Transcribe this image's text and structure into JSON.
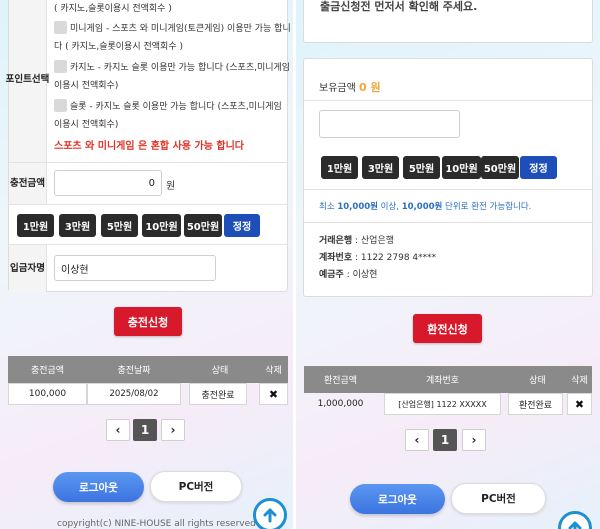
{
  "left": {
    "point_select": {
      "label": "포인트선택",
      "note_top": "( 카지노,슬롯이용시 전액회수 )",
      "options": [
        {
          "text": "미니게임 - 스포츠 와 미니게임(토큰게임) 이용만 가능 합니",
          "text2": "다 ( 카지노,슬롯이용시 전액회수 )"
        },
        {
          "text": "카지노 - 카지노 슬롯 이용만 가능 합니다 (스포츠,미니게임",
          "text2": "이용시 전액회수)"
        },
        {
          "text": "슬롯 - 카지노 슬롯 이용만 가능 합니다 (스포츠,미니게임",
          "text2": "이용시 전액회수)"
        }
      ],
      "warning": "스포츠 와 미니게임 은 혼합 사용 가능 합니다"
    },
    "charge_amount": {
      "label": "충전금액",
      "value": "0",
      "unit": "원"
    },
    "amount_buttons": [
      "1만원",
      "3만원",
      "5만원",
      "10만원",
      "50만원"
    ],
    "reset_label": "정정",
    "depositor": {
      "label": "입금자명",
      "value": "이상현"
    },
    "submit_label": "충전신청",
    "table": {
      "headers": [
        "충전금액",
        "충전날짜",
        "상태",
        "삭제"
      ],
      "rows": [
        {
          "amount": "100,000",
          "date": "2025/08/02",
          "status": "충전완료",
          "del": "✖"
        }
      ]
    },
    "pager": {
      "prev": "‹",
      "page": "1",
      "next": "›"
    },
    "logout_label": "로그아웃",
    "pc_label": "PC버전",
    "copyright": "copyright(c) NINE-HOUSE all rights reserved"
  },
  "right": {
    "top_text": "출금신청전 먼저서 확인해 주세요.",
    "balance_label": "보유금액",
    "balance_value": "0 원",
    "amount_buttons": [
      "1만원",
      "3만원",
      "5만원",
      "10만원",
      "50만원"
    ],
    "reset_label": "정정",
    "info": {
      "a": "최소 ",
      "b": "10,000원",
      "c": " 이상, ",
      "d": "10,000원",
      "e": " 단위로 환전 가능합니다."
    },
    "bank": {
      "bank_label": "거래은행",
      "bank_value": " : 산업은행",
      "account_label": "계좌번호",
      "account_value": " : 1122 2798 4****",
      "holder_label": "예금주",
      "holder_value": " : 이상현"
    },
    "submit_label": "환전신청",
    "table": {
      "headers": [
        "환전금액",
        "계좌번호",
        "상태",
        "삭제"
      ],
      "rows": [
        {
          "amount": "1,000,000",
          "account": "[산업은행] 1122 XXXXX",
          "status": "환전완료",
          "del": "✖"
        }
      ]
    },
    "pager": {
      "prev": "‹",
      "page": "1",
      "next": "›"
    },
    "logout_label": "로그아웃",
    "pc_label": "PC버전"
  },
  "icons": {
    "scroll_top": "arrow-up-circle-icon"
  },
  "colors": {
    "accent_red": "#d8182b",
    "accent_blue": "#1e4fb8",
    "warning": "#e03226",
    "balance": "#f0a63a"
  }
}
